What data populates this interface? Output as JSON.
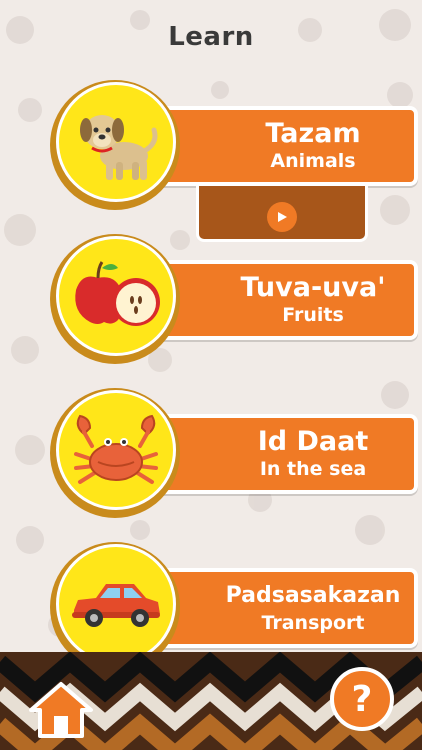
{
  "header": {
    "title": "Learn"
  },
  "categories": [
    {
      "name": "Tazam",
      "subtitle": "Animals",
      "icon": "dog-icon"
    },
    {
      "name": "Tuva-uva'",
      "subtitle": "Fruits",
      "icon": "apple-icon"
    },
    {
      "name": "Id Daat",
      "subtitle": "In the sea",
      "icon": "crab-icon"
    },
    {
      "name": "Padsasakazan",
      "subtitle": "Transport",
      "icon": "car-icon"
    }
  ],
  "colors": {
    "accent": "#f07a25",
    "circle": "#ffe619",
    "panel": "#a7561a",
    "background": "#f1ebe7"
  },
  "footer": {
    "home_icon": "home-icon",
    "help_label": "?"
  }
}
